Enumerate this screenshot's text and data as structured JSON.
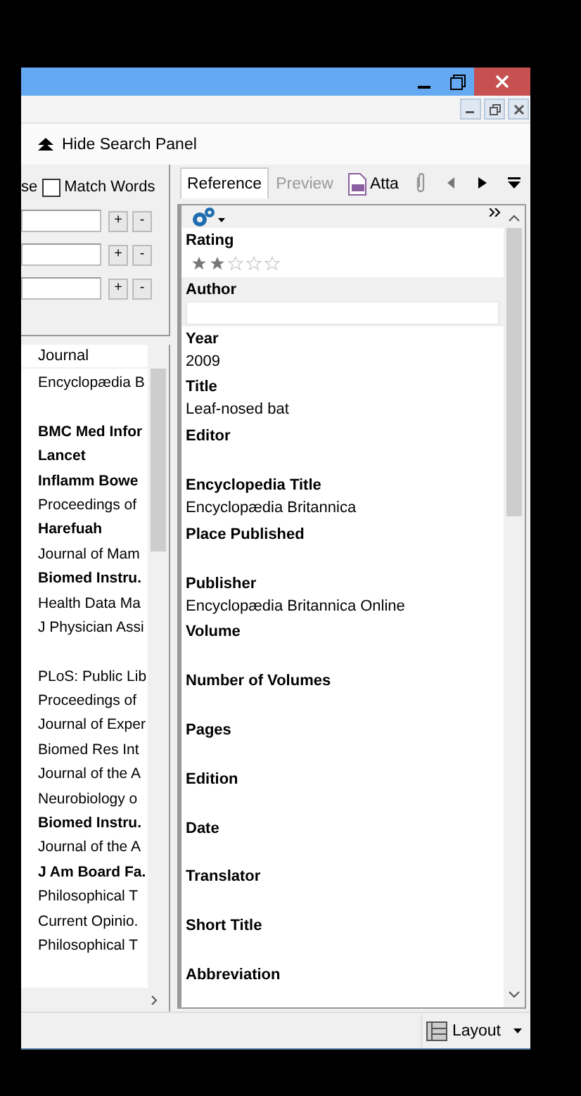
{
  "toolbar": {
    "hide_search_panel": "Hide Search Panel"
  },
  "search": {
    "case_fragment": "se",
    "match_words": {
      "label": "Match Words",
      "checked": false
    },
    "rows": [
      {
        "add": "+",
        "remove": "-"
      },
      {
        "add": "+",
        "remove": "-"
      },
      {
        "add": "+",
        "remove": "-"
      }
    ]
  },
  "library": {
    "columns": [
      "Journal"
    ],
    "rows": [
      {
        "kind": "journal",
        "journal": "Encyclopædia B",
        "unread": false
      },
      {
        "kind": "blank"
      },
      {
        "kind": "journal",
        "journal": "BMC Med Infor",
        "unread": true
      },
      {
        "kind": "journal",
        "journal": "Lancet",
        "unread": true
      },
      {
        "kind": "journal",
        "journal": "Inflamm Bowe",
        "unread": true
      },
      {
        "kind": "journal",
        "journal": "Proceedings of",
        "unread": false
      },
      {
        "kind": "journal",
        "journal": "Harefuah",
        "unread": true
      },
      {
        "kind": "journal",
        "journal": "Journal of Mam",
        "unread": false
      },
      {
        "kind": "journal",
        "journal": "Biomed Instru.",
        "unread": true
      },
      {
        "kind": "journal",
        "journal": "Health Data Ma",
        "unread": false
      },
      {
        "kind": "journal",
        "journal": "J Physician Assi",
        "unread": false
      },
      {
        "kind": "blank"
      },
      {
        "kind": "journal",
        "journal": "PLoS: Public Lib",
        "unread": false
      },
      {
        "kind": "journal",
        "journal": "Proceedings of",
        "unread": false
      },
      {
        "kind": "journal",
        "journal": "Journal of Exper",
        "unread": false
      },
      {
        "kind": "journal",
        "journal": "Biomed Res Int",
        "unread": false
      },
      {
        "kind": "journal",
        "journal": "Journal of the A",
        "unread": false
      },
      {
        "kind": "journal",
        "journal": "Neurobiology o",
        "unread": false
      },
      {
        "kind": "journal",
        "journal": "Biomed Instru.",
        "unread": true
      },
      {
        "kind": "journal",
        "journal": "Journal of the A",
        "unread": false
      },
      {
        "kind": "journal",
        "journal": "J Am Board Fa.",
        "unread": true
      },
      {
        "kind": "journal",
        "journal": "Philosophical T",
        "unread": false
      },
      {
        "kind": "journal",
        "journal": "Current Opinio.",
        "unread": false
      },
      {
        "kind": "journal",
        "journal": "Philosophical T",
        "unread": false
      }
    ]
  },
  "tabs": [
    {
      "label": "Reference",
      "kind": "text",
      "selected": true,
      "disabled": false
    },
    {
      "label": "Preview",
      "kind": "text",
      "selected": false,
      "disabled": true
    },
    {
      "label": "Atta",
      "kind": "pdf",
      "selected": false,
      "disabled": false
    }
  ],
  "fields": [
    {
      "kind": "rating",
      "label": "Rating",
      "stars": 2,
      "focused": false
    },
    {
      "kind": "text",
      "label": "Author",
      "focused": true
    },
    {
      "kind": "text",
      "label": "Year",
      "value": "2009",
      "focused": false
    },
    {
      "kind": "text",
      "label": "Title",
      "value": "Leaf-nosed bat",
      "focused": false
    },
    {
      "kind": "text",
      "label": "Editor",
      "focused": false
    },
    {
      "kind": "text",
      "label": "Encyclopedia Title",
      "value": "Encyclopædia Britannica",
      "focused": false
    },
    {
      "kind": "text",
      "label": "Place Published",
      "focused": false
    },
    {
      "kind": "text",
      "label": "Publisher",
      "value": "Encyclopædia Britannica Online",
      "focused": false
    },
    {
      "kind": "text",
      "label": "Volume",
      "focused": false
    },
    {
      "kind": "text",
      "label": "Number of Volumes",
      "focused": false
    },
    {
      "kind": "text",
      "label": "Pages",
      "focused": false
    },
    {
      "kind": "text",
      "label": "Edition",
      "focused": false
    },
    {
      "kind": "text",
      "label": "Date",
      "focused": false
    },
    {
      "kind": "text",
      "label": "Translator",
      "focused": false
    },
    {
      "kind": "text",
      "label": "Short Title",
      "focused": false
    },
    {
      "kind": "text",
      "label": "Abbreviation",
      "focused": false
    }
  ],
  "status_bar": {
    "layout": "Layout"
  }
}
